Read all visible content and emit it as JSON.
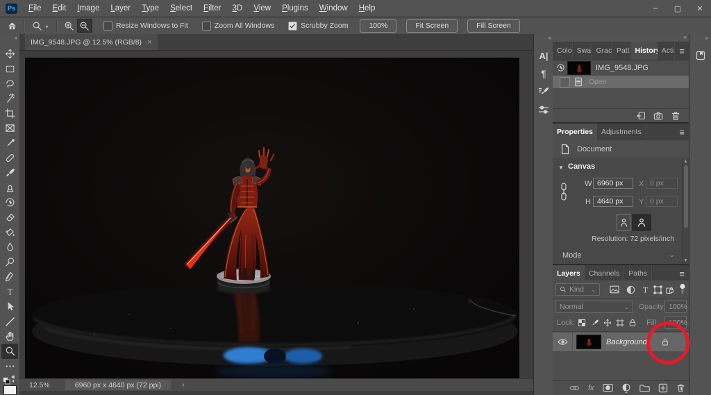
{
  "app": {
    "logo": "Ps"
  },
  "titlebar": {
    "menus": [
      "File",
      "Edit",
      "Image",
      "Layer",
      "Type",
      "Select",
      "Filter",
      "3D",
      "View",
      "Plugins",
      "Window",
      "Help"
    ],
    "window_controls": {
      "minimize": "–",
      "maximize": "▢",
      "close": "✕"
    }
  },
  "options_bar": {
    "checkboxes": [
      {
        "label": "Resize Windows to Fit",
        "checked": false
      },
      {
        "label": "Zoom All Windows",
        "checked": false
      },
      {
        "label": "Scrubby Zoom",
        "checked": true
      }
    ],
    "buttons": [
      "100%",
      "Fit Screen",
      "Fill Screen"
    ]
  },
  "document_tab": {
    "title": "IMG_9548.JPG @ 12.5% (RGB/8)",
    "close": "×"
  },
  "toolbar": {
    "tools": [
      "move-tool",
      "marquee-tool",
      "lasso-tool",
      "magic-wand-tool",
      "crop-tool",
      "frame-tool",
      "eyedropper-tool",
      "healing-tool",
      "brush-tool",
      "clone-stamp-tool",
      "history-brush-tool",
      "eraser-tool",
      "paint-bucket-tool",
      "blur-tool",
      "dodge-tool",
      "pen-tool",
      "type-tool",
      "path-select-tool",
      "line-tool",
      "hand-tool",
      "zoom-tool",
      "more-tools"
    ],
    "active_tool": "zoom-tool"
  },
  "right_dock": {
    "icons": [
      "character-panel",
      "paragraph-panel",
      "brush-settings-panel",
      "tool-presets-panel"
    ],
    "libraries_icon": "libraries-panel"
  },
  "history_panel": {
    "tabs": [
      "Colo",
      "Swa",
      "Grac",
      "Patt",
      "History",
      "Acti"
    ],
    "active_tab": "History",
    "snapshot": {
      "label": "IMG_9548.JPG"
    },
    "states": [
      {
        "label": "Open",
        "selected": true
      }
    ]
  },
  "properties_panel": {
    "tabs": [
      "Properties",
      "Adjustments"
    ],
    "active_tab": "Properties",
    "document_label": "Document",
    "section_title": "Canvas",
    "fields": {
      "w_label": "W",
      "w_value": "6960 px",
      "x_label": "X",
      "x_value": "0 px",
      "h_label": "H",
      "h_value": "4640 px",
      "y_label": "Y",
      "y_value": "0 px"
    },
    "resolution": "Resolution: 72 pixels/inch",
    "mode_label": "Mode"
  },
  "layers_panel": {
    "tabs": [
      "Layers",
      "Channels",
      "Paths"
    ],
    "active_tab": "Layers",
    "filter_label": "Kind",
    "blend_mode": "Normal",
    "opacity_label": "Opacity:",
    "opacity_value": "100%",
    "lock_label": "Lock:",
    "fill_label": "Fill:",
    "fill_value": "100%",
    "layer": {
      "name": "Background",
      "locked": true
    }
  },
  "status_bar": {
    "zoom": "12.5%",
    "dimensions": "6960 px x 4640 px (72 ppi)",
    "chevron": "›"
  },
  "annotation": {
    "shape": "red-circle",
    "target": "background-layer-lock-icon",
    "color": "#e7182b"
  },
  "theme": {
    "chrome": "#535353",
    "panel": "#4e4e4e",
    "selection": "#6b6b6b",
    "canvas_bg": "#0a0808",
    "accent_red": "#e7182b",
    "figure_red": "#a52a16",
    "glow_blue": "#2e7fd2"
  }
}
